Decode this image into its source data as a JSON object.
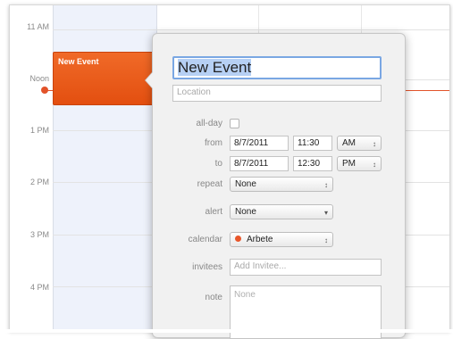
{
  "calendar": {
    "times": [
      "11 AM",
      "Noon",
      "1 PM",
      "2 PM",
      "3 PM",
      "4 PM"
    ],
    "event": {
      "title": "New Event"
    },
    "colors": {
      "event": "#e9561a",
      "now_line": "#e2532a",
      "today": "#eef2fb"
    }
  },
  "popover": {
    "title": "New Event",
    "location_placeholder": "Location",
    "allday_label": "all-day",
    "from_label": "from",
    "from_date": "8/7/2011",
    "from_time": "11:30",
    "from_ampm": "AM",
    "to_label": "to",
    "to_date": "8/7/2011",
    "to_time": "12:30",
    "to_ampm": "PM",
    "repeat_label": "repeat",
    "repeat_value": "None",
    "alert_label": "alert",
    "alert_value": "None",
    "calendar_label": "calendar",
    "calendar_value": "Arbete",
    "invitees_label": "invitees",
    "invitees_placeholder": "Add Invitee...",
    "note_label": "note",
    "note_placeholder": "None",
    "icons": {
      "stepper": "stepper-icon",
      "dropdown": "chevron-down-icon"
    }
  }
}
